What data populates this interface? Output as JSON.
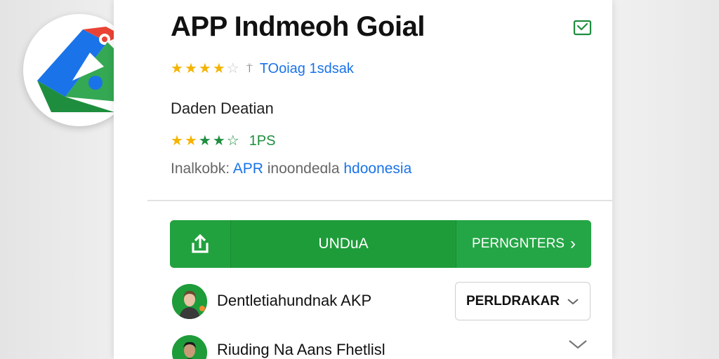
{
  "app": {
    "title": "APP Indmeoh  Goial",
    "developer": "TOoiag 1sdsak",
    "category": "Daden Deatian",
    "rating_badge": "1PS",
    "info_prefix": "Inalkobk: ",
    "info_link": "APR",
    "info_mid": " inoondeɑla ",
    "info_link2": "hdoonesia"
  },
  "ratings": {
    "top_stars": 4,
    "second_stars": 4
  },
  "buttons": {
    "install": "UNDuA",
    "more": "PERNGNTERS"
  },
  "reviews": [
    {
      "text": "Dentletiahundnak AKP"
    },
    {
      "text": "Riuding Na Aans Fhetlisl"
    }
  ],
  "dropdown": {
    "label": "PERLDRAKAR"
  },
  "icons": {
    "mail": "mail-check-icon",
    "share": "share-upload-icon",
    "chevron": "chevron-down-icon"
  },
  "colors": {
    "accent_green": "#1e9c3a",
    "link_blue": "#1a73e8",
    "star_gold": "#f4b400"
  }
}
